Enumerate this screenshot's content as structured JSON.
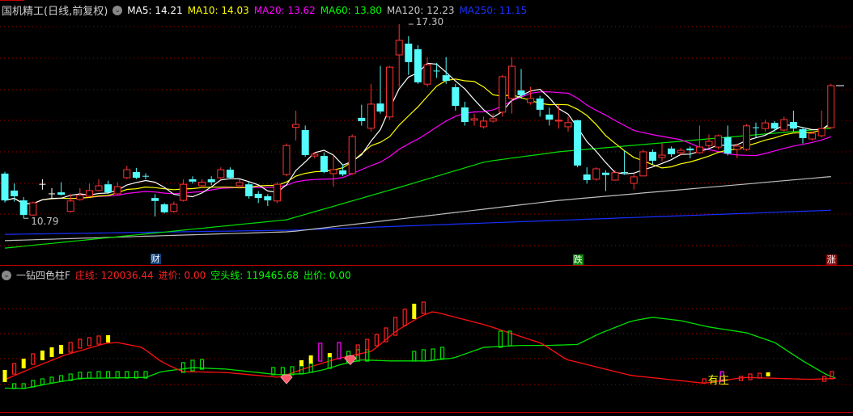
{
  "header": {
    "stock_title": "国机精工(日线,前复权)",
    "ma5": "MA5: 14.21",
    "ma10": "MA10: 14.03",
    "ma20": "MA20: 13.62",
    "ma60": "MA60: 13.80",
    "ma120": "MA120: 12.23",
    "ma250": "MA250: 11.15"
  },
  "indicator_header": {
    "name": "一钻四色柱F",
    "zhuang_line": "庄线: 120036.44",
    "jin_price": "进价: 0.00",
    "kongtou_line": "空头线: 119465.68",
    "chu_price": "出价: 0.00"
  },
  "colors": {
    "up": "#ff3232",
    "down": "#54fcfc",
    "ma5": "#ffffff",
    "ma10": "#ffff00",
    "ma20": "#ff00ff",
    "ma60": "#00e000",
    "ma120": "#c0c0c0",
    "ma250": "#1830ff",
    "grid": "#a00000"
  },
  "markers": {
    "cai": "财",
    "die": "跌",
    "zhang": "涨",
    "you_zhuang": "有庄"
  },
  "chart_data": {
    "type": "candlestick",
    "price_labels": {
      "high": {
        "index": 43,
        "value": "17.30"
      },
      "low": {
        "index": 2,
        "value": "10.79"
      }
    },
    "ohlc": [
      [
        12.29,
        11.39,
        12.35,
        11.32
      ],
      [
        11.72,
        11.53,
        11.96,
        11.35
      ],
      [
        11.39,
        10.9,
        11.5,
        10.79
      ],
      [
        10.9,
        11.31,
        11.35,
        10.88
      ],
      [
        11.93,
        11.93,
        12.1,
        11.75
      ],
      [
        11.61,
        11.61,
        11.8,
        11.45
      ],
      [
        11.66,
        11.58,
        12.0,
        11.55
      ],
      [
        11.02,
        11.37,
        11.6,
        10.98
      ],
      [
        11.42,
        11.56,
        11.8,
        11.38
      ],
      [
        11.53,
        11.72,
        11.95,
        11.5
      ],
      [
        11.72,
        11.88,
        12.1,
        11.7
      ],
      [
        11.93,
        11.66,
        12.05,
        11.6
      ],
      [
        11.61,
        11.85,
        12.0,
        11.58
      ],
      [
        12.15,
        12.42,
        12.55,
        12.1
      ],
      [
        12.34,
        12.15,
        12.48,
        12.1
      ],
      [
        12.2,
        12.2,
        12.3,
        12.1
      ],
      [
        11.47,
        11.37,
        11.6,
        10.85
      ],
      [
        11.26,
        10.99,
        11.3,
        10.95
      ],
      [
        11.02,
        11.26,
        11.35,
        10.98
      ],
      [
        11.39,
        11.93,
        12.1,
        11.35
      ],
      [
        12.1,
        12.02,
        12.2,
        11.95
      ],
      [
        11.88,
        12.0,
        12.1,
        11.82
      ],
      [
        12.1,
        12.0,
        12.2,
        11.9
      ],
      [
        12.15,
        12.42,
        12.5,
        12.1
      ],
      [
        12.42,
        12.15,
        12.5,
        12.1
      ],
      [
        11.88,
        11.99,
        12.1,
        11.8
      ],
      [
        11.93,
        11.53,
        12.0,
        11.45
      ],
      [
        11.61,
        11.47,
        11.7,
        11.3
      ],
      [
        11.53,
        11.39,
        11.6,
        11.2
      ],
      [
        11.37,
        11.93,
        12.0,
        11.3
      ],
      [
        12.26,
        13.23,
        13.3,
        12.2
      ],
      [
        13.84,
        13.94,
        14.4,
        13.4
      ],
      [
        13.75,
        12.91,
        13.9,
        12.85
      ],
      [
        12.88,
        12.94,
        13.0,
        12.8
      ],
      [
        12.88,
        12.34,
        13.0,
        12.3
      ],
      [
        12.29,
        12.42,
        12.9,
        11.85
      ],
      [
        12.4,
        12.26,
        12.6,
        12.2
      ],
      [
        12.29,
        13.53,
        13.6,
        12.25
      ],
      [
        14.16,
        14.05,
        14.6,
        13.9
      ],
      [
        13.81,
        14.62,
        15.3,
        13.7
      ],
      [
        14.64,
        14.37,
        15.9,
        14.3
      ],
      [
        14.19,
        15.86,
        15.9,
        14.1
      ],
      [
        16.27,
        16.76,
        17.3,
        15.2
      ],
      [
        16.65,
        16.03,
        16.9,
        15.6
      ],
      [
        16.46,
        15.35,
        16.6,
        15.3
      ],
      [
        15.29,
        15.94,
        16.2,
        15.2
      ],
      [
        15.73,
        15.73,
        16.0,
        15.5
      ],
      [
        15.59,
        15.4,
        16.2,
        15.3
      ],
      [
        15.19,
        14.56,
        15.3,
        14.4
      ],
      [
        14.51,
        14.02,
        14.7,
        13.9
      ],
      [
        14.08,
        14.13,
        14.3,
        13.9
      ],
      [
        13.86,
        14.05,
        14.2,
        13.8
      ],
      [
        14.05,
        14.13,
        14.3,
        14.0
      ],
      [
        14.35,
        15.54,
        15.6,
        14.2
      ],
      [
        14.81,
        15.89,
        16.2,
        14.3
      ],
      [
        15.08,
        14.92,
        15.8,
        14.8
      ],
      [
        14.67,
        14.81,
        15.2,
        14.6
      ],
      [
        14.81,
        14.43,
        14.9,
        14.2
      ],
      [
        14.27,
        14.1,
        14.5,
        13.9
      ],
      [
        14.05,
        14.08,
        14.6,
        13.8
      ],
      [
        13.86,
        14.0,
        14.2,
        13.7
      ],
      [
        14.08,
        12.56,
        14.1,
        12.5
      ],
      [
        12.26,
        12.07,
        12.5,
        11.95
      ],
      [
        12.1,
        12.45,
        12.5,
        12.05
      ],
      [
        12.32,
        12.24,
        12.4,
        11.7
      ],
      [
        12.07,
        12.32,
        12.4,
        12.05
      ],
      [
        12.34,
        12.32,
        13.05,
        12.25
      ],
      [
        11.96,
        12.18,
        12.3,
        11.75
      ],
      [
        12.21,
        13.02,
        13.1,
        12.2
      ],
      [
        13.02,
        12.72,
        13.1,
        12.6
      ],
      [
        12.83,
        12.91,
        13.3,
        12.7
      ],
      [
        13.13,
        12.94,
        13.2,
        12.85
      ],
      [
        12.99,
        13.07,
        13.15,
        12.9
      ],
      [
        13.13,
        13.07,
        13.2,
        12.8
      ],
      [
        12.99,
        13.18,
        13.9,
        12.95
      ],
      [
        13.23,
        13.37,
        13.6,
        13.15
      ],
      [
        13.18,
        13.56,
        13.6,
        13.1
      ],
      [
        13.51,
        12.96,
        13.9,
        12.9
      ],
      [
        13.1,
        13.21,
        13.3,
        12.8
      ],
      [
        13.1,
        13.89,
        13.95,
        13.05
      ],
      [
        13.83,
        13.83,
        14.0,
        13.5
      ],
      [
        13.8,
        13.99,
        14.1,
        13.7
      ],
      [
        13.99,
        13.8,
        14.05,
        13.7
      ],
      [
        13.75,
        14.1,
        14.2,
        13.7
      ],
      [
        14.02,
        13.8,
        14.4,
        13.7
      ],
      [
        13.78,
        13.48,
        13.85,
        13.3
      ],
      [
        13.45,
        13.64,
        13.7,
        13.4
      ],
      [
        13.56,
        13.8,
        14.4,
        13.5
      ],
      [
        13.83,
        15.24,
        15.3,
        13.8
      ]
    ],
    "long_ma_anchors": {
      "ma60": [
        [
          0,
          9.79
        ],
        [
          30,
          10.74
        ],
        [
          42.6,
          11.88
        ],
        [
          51.2,
          12.69
        ],
        [
          59,
          13.02
        ],
        [
          88.8,
          13.83
        ]
      ],
      "ma120": [
        [
          0,
          10.04
        ],
        [
          30.5,
          10.34
        ],
        [
          59,
          11.39
        ],
        [
          88.8,
          12.21
        ]
      ],
      "ma250": [
        [
          0,
          10.25
        ],
        [
          30.5,
          10.39
        ],
        [
          88.8,
          11.07
        ]
      ]
    },
    "event_markers": {
      "cai": 16,
      "die": 61,
      "zhang": 88
    },
    "indicator": {
      "zhuang_line": [
        [
          0,
          16.7
        ],
        [
          3,
          29
        ],
        [
          6.4,
          42
        ],
        [
          10.7,
          54
        ],
        [
          12,
          55
        ],
        [
          14.6,
          50
        ],
        [
          16.7,
          35
        ],
        [
          18.9,
          25
        ],
        [
          23.6,
          24
        ],
        [
          29.2,
          19
        ],
        [
          32.2,
          29
        ],
        [
          35.7,
          39
        ],
        [
          39.1,
          46
        ],
        [
          41.7,
          67
        ],
        [
          44.3,
          82
        ],
        [
          45.6,
          87
        ],
        [
          51.2,
          73
        ],
        [
          57.2,
          54
        ],
        [
          59.8,
          37.5
        ],
        [
          66.7,
          21
        ],
        [
          74.5,
          13
        ],
        [
          78.8,
          19
        ],
        [
          85.7,
          17
        ],
        [
          88.8,
          18
        ]
      ],
      "kongtou_line": [
        [
          0,
          8
        ],
        [
          2,
          7.5
        ],
        [
          4.7,
          12.5
        ],
        [
          8,
          18
        ],
        [
          15,
          19
        ],
        [
          16.7,
          25
        ],
        [
          20,
          29
        ],
        [
          23.6,
          27.5
        ],
        [
          29.2,
          21.7
        ],
        [
          32,
          23
        ],
        [
          34,
          27
        ],
        [
          35.7,
          32
        ],
        [
          38,
          37
        ],
        [
          41,
          36
        ],
        [
          45,
          36
        ],
        [
          47.8,
          39
        ],
        [
          51,
          50
        ],
        [
          55,
          52
        ],
        [
          58,
          52
        ],
        [
          61,
          53
        ],
        [
          63.3,
          64
        ],
        [
          66.7,
          77
        ],
        [
          69,
          81
        ],
        [
          72,
          77.5
        ],
        [
          75,
          71
        ],
        [
          79,
          65
        ],
        [
          82,
          55
        ],
        [
          85,
          36
        ],
        [
          87.4,
          22.5
        ],
        [
          88.8,
          17
        ]
      ],
      "bars": [
        [
          0,
          "yellow",
          14.2,
          26.7
        ],
        [
          1,
          "red",
          22.5,
          33.3
        ],
        [
          1,
          "green",
          7.5,
          12.5
        ],
        [
          2,
          "yellow",
          28.3,
          38.3
        ],
        [
          2,
          "green",
          7.5,
          12.5
        ],
        [
          3,
          "red",
          32.5,
          43.3
        ],
        [
          3,
          "green",
          9.2,
          15.8
        ],
        [
          4,
          "yellow",
          36.7,
          46.7
        ],
        [
          4,
          "green",
          11.7,
          17.5
        ],
        [
          5,
          "yellow",
          40,
          50
        ],
        [
          5,
          "green",
          13.3,
          19.2
        ],
        [
          6,
          "yellow",
          43.3,
          52.5
        ],
        [
          6,
          "green",
          15,
          20.8
        ],
        [
          7,
          "red",
          45,
          55
        ],
        [
          7,
          "green",
          15.8,
          22.5
        ],
        [
          8,
          "red",
          49.2,
          58.3
        ],
        [
          8,
          "green",
          17.5,
          24.2
        ],
        [
          9,
          "red",
          51.7,
          60
        ],
        [
          9,
          "green",
          18.3,
          24.2
        ],
        [
          10,
          "red",
          53.3,
          61.7
        ],
        [
          10,
          "green",
          18.3,
          25
        ],
        [
          11,
          "yellow",
          55,
          62.5
        ],
        [
          11,
          "green",
          18.3,
          25
        ],
        [
          12,
          "green",
          18.3,
          25
        ],
        [
          13,
          "green",
          18.3,
          25
        ],
        [
          14,
          "green",
          18.3,
          25
        ],
        [
          15,
          "green",
          18.3,
          25
        ],
        [
          19,
          "green",
          24.2,
          34.2
        ],
        [
          20,
          "green",
          25.8,
          36.7
        ],
        [
          21,
          "green",
          27.5,
          37.5
        ],
        [
          28.6,
          "green",
          21.7,
          29.2
        ],
        [
          29.6,
          "green",
          21.7,
          29.2
        ],
        [
          30.6,
          "green",
          21.7,
          30
        ],
        [
          31.6,
          "green",
          22.5,
          30.8
        ],
        [
          31.6,
          "yellow",
          30.8,
          36.7
        ],
        [
          32.6,
          "green",
          24.2,
          33.3
        ],
        [
          32.6,
          "yellow",
          33.3,
          41.7
        ],
        [
          33.6,
          "magenta",
          35.8,
          54.2
        ],
        [
          34.6,
          "green",
          28.3,
          40
        ],
        [
          34.6,
          "yellow",
          40,
          44.2
        ],
        [
          35.6,
          "magenta",
          38.3,
          55
        ],
        [
          36.6,
          "green",
          34.2,
          45.8
        ],
        [
          37.6,
          "green",
          35.8,
          47.5
        ],
        [
          37.6,
          "red",
          41.7,
          52.5
        ],
        [
          38.6,
          "green",
          35.8,
          47.5
        ],
        [
          38.6,
          "red",
          47.5,
          58.3
        ],
        [
          39.6,
          "red",
          51.7,
          63.3
        ],
        [
          40.6,
          "red",
          55.8,
          70
        ],
        [
          41.6,
          "red",
          62.5,
          80.8
        ],
        [
          42.6,
          "red",
          72.5,
          89.2
        ],
        [
          43.6,
          "green",
          35.8,
          45.8
        ],
        [
          43.6,
          "yellow",
          79.2,
          95
        ],
        [
          44.6,
          "green",
          35.8,
          47.5
        ],
        [
          44.6,
          "red",
          85,
          96.7
        ],
        [
          45.6,
          "green",
          36.7,
          48.3
        ],
        [
          46.6,
          "green",
          38.3,
          50
        ],
        [
          52.8,
          "green",
          50,
          66.7
        ],
        [
          53.8,
          "green",
          51.7,
          66.7
        ],
        [
          74.5,
          "red",
          13.3,
          17.5
        ],
        [
          76.4,
          "magenta",
          15,
          25
        ],
        [
          78.4,
          "red",
          15.8,
          20
        ],
        [
          79.4,
          "red",
          16.7,
          22.5
        ],
        [
          80.4,
          "red",
          18.3,
          23.3
        ],
        [
          81.3,
          "yellow",
          20,
          24.2
        ],
        [
          87.3,
          "red",
          15,
          20
        ],
        [
          88.1,
          "red",
          17.5,
          25
        ]
      ],
      "diamonds": [
        30,
        36.8
      ],
      "you_zhuang_index": 75.5
    }
  }
}
